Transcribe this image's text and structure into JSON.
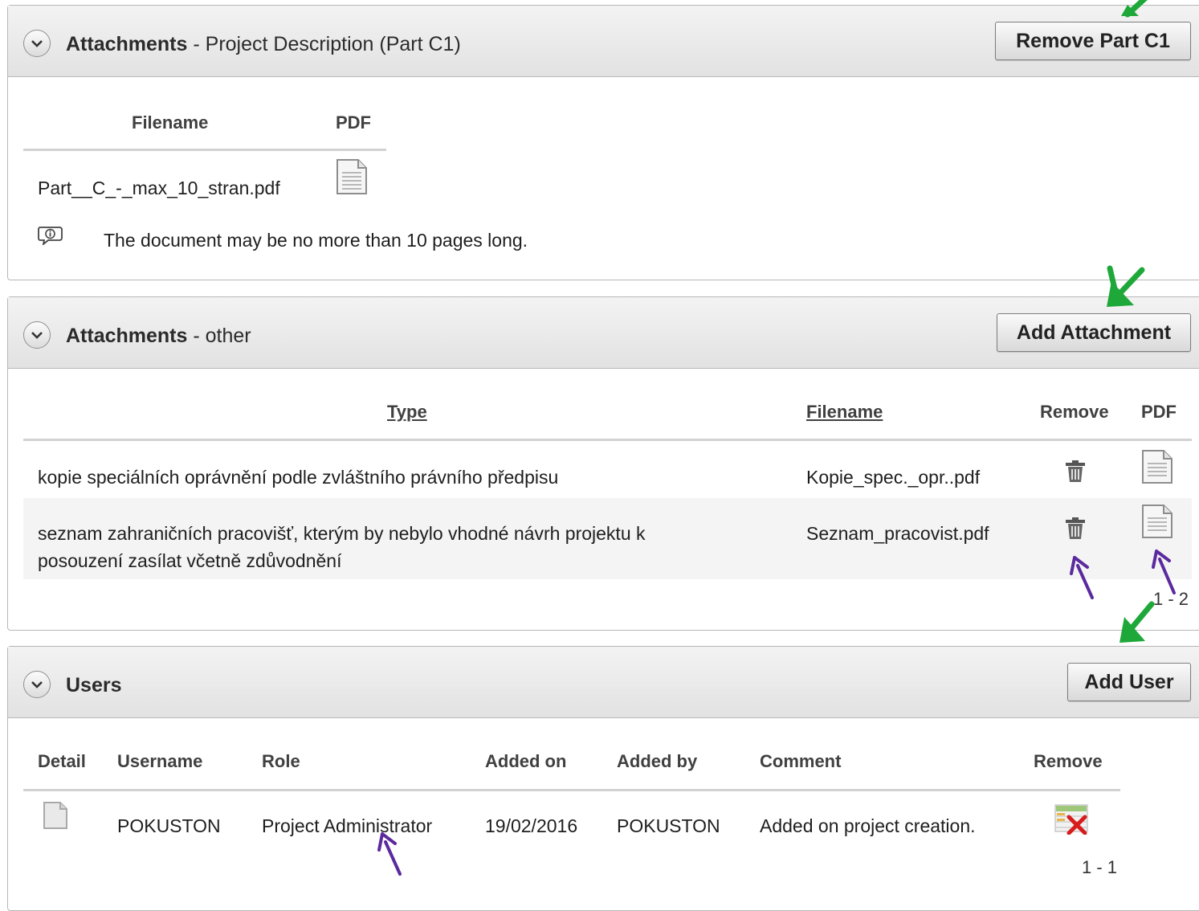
{
  "panel_c1": {
    "title": "Attachments",
    "subtitle": " - Project Description (Part C1)",
    "remove_button": "Remove Part C1",
    "headers": {
      "filename": "Filename",
      "pdf": "PDF"
    },
    "file": "Part__C_-_max_10_stran.pdf",
    "info_note": "The document may be no more than 10 pages long."
  },
  "panel_other": {
    "title": "Attachments",
    "subtitle": " - other",
    "add_button": "Add Attachment",
    "headers": {
      "type": "Type",
      "filename": "Filename",
      "remove": "Remove",
      "pdf": "PDF"
    },
    "rows": [
      {
        "type_line1": "kopie speciálních oprávnění podle zvláštního právního předpisu",
        "type_line2": "",
        "filename": "Kopie_spec._opr..pdf"
      },
      {
        "type_line1": "seznam zahraničních pracovišť, kterým by nebylo vhodné návrh projektu k",
        "type_line2": "posouzení zasílat včetně zdůvodnění",
        "filename": "Seznam_pracovist.pdf"
      }
    ],
    "pager": "1 - 2"
  },
  "panel_users": {
    "title": "Users",
    "add_button": "Add User",
    "headers": {
      "detail": "Detail",
      "username": "Username",
      "role": "Role",
      "added_on": "Added on",
      "added_by": "Added by",
      "comment": "Comment",
      "remove": "Remove"
    },
    "rows": [
      {
        "username": "POKUSTON",
        "role": "Project Administrator",
        "added_on": "19/02/2016",
        "added_by": "POKUSTON",
        "comment": "Added on project creation."
      }
    ],
    "pager": "1 - 1"
  },
  "colors": {
    "annotation_green": "#1fa83a",
    "annotation_purple": "#5b2a9e"
  }
}
